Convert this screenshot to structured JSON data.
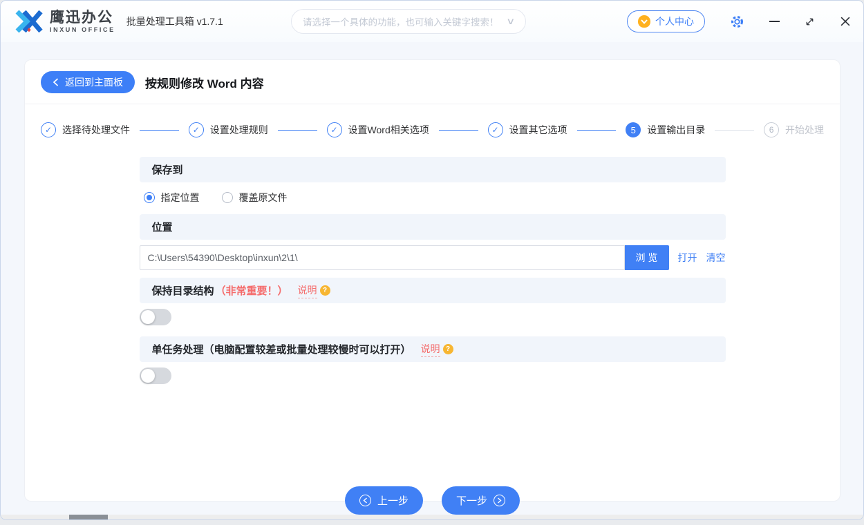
{
  "colors": {
    "accent": "#4080f5",
    "danger": "#f56c6c",
    "badge_orange": "#f7b632",
    "vip_orange": "#ffb11f"
  },
  "topbar": {
    "brand_cn": "鹰迅办公",
    "brand_en": "INXUN OFFICE",
    "app_title": "批量处理工具箱 v1.7.1",
    "function_select_placeholder": "请选择一个具体的功能，也可输入关键字搜索！",
    "user_center_label": "个人中心"
  },
  "page": {
    "back_label": "返回到主面板",
    "title": "按规则修改 Word 内容"
  },
  "steps": [
    {
      "number": 1,
      "label": "选择待处理文件",
      "state": "done"
    },
    {
      "number": 2,
      "label": "设置处理规则",
      "state": "done"
    },
    {
      "number": 3,
      "label": "设置Word相关选项",
      "state": "done"
    },
    {
      "number": 4,
      "label": "设置其它选项",
      "state": "done"
    },
    {
      "number": 5,
      "label": "设置输出目录",
      "state": "current"
    },
    {
      "number": 6,
      "label": "开始处理",
      "state": "pending"
    }
  ],
  "form": {
    "save_to": {
      "header": "保存到",
      "options": [
        {
          "label": "指定位置",
          "selected": true
        },
        {
          "label": "覆盖原文件",
          "selected": false
        }
      ]
    },
    "location": {
      "header": "位置",
      "path": "C:\\Users\\54390\\Desktop\\inxun\\2\\1\\",
      "browse_label": "浏 览",
      "open_label": "打开",
      "clear_label": "清空"
    },
    "keep_structure": {
      "title": "保持目录结构",
      "warning": "（非常重要！）",
      "help_label": "说明",
      "enabled": false
    },
    "single_task": {
      "title": "单任务处理（电脑配置较差或批量处理较慢时可以打开）",
      "help_label": "说明",
      "enabled": false
    }
  },
  "footer": {
    "prev_label": "上一步",
    "next_label": "下一步"
  }
}
